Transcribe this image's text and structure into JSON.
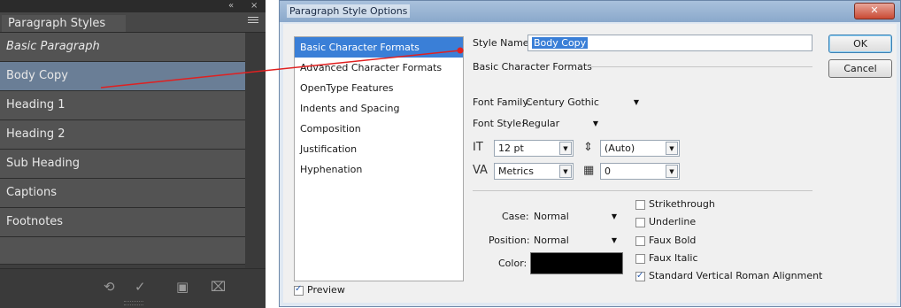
{
  "panel": {
    "tab_title": "Paragraph Styles",
    "collapse_icon": "«",
    "close_icon": "×",
    "styles": [
      {
        "label": "Basic Paragraph"
      },
      {
        "label": "Body Copy"
      },
      {
        "label": "Heading 1"
      },
      {
        "label": "Heading 2"
      },
      {
        "label": "Sub Heading"
      },
      {
        "label": "Captions"
      },
      {
        "label": "Footnotes"
      }
    ],
    "bottom_icons": [
      "clear-overrides-icon",
      "redefine-style-icon",
      "new-style-icon",
      "delete-style-icon"
    ]
  },
  "dialog": {
    "title": "Paragraph Style Options",
    "categories": [
      "Basic Character Formats",
      "Advanced Character Formats",
      "OpenType Features",
      "Indents and Spacing",
      "Composition",
      "Justification",
      "Hyphenation"
    ],
    "preview_label": "Preview",
    "style_name_label": "Style Name:",
    "style_name_value": "Body Copy",
    "section_title": "Basic Character Formats",
    "font_family_label": "Font Family:",
    "font_family_value": "Century Gothic",
    "font_style_label": "Font Style:",
    "font_style_value": "Regular",
    "size_value": "12 pt",
    "leading_value": "(Auto)",
    "kerning_value": "Metrics",
    "tracking_value": "0",
    "case_label": "Case:",
    "case_value": "Normal",
    "position_label": "Position:",
    "position_value": "Normal",
    "color_label": "Color:",
    "color_value": "#000000",
    "checkboxes": {
      "strikethrough": "Strikethrough",
      "underline": "Underline",
      "faux_bold": "Faux Bold",
      "faux_italic": "Faux Italic",
      "svra": "Standard Vertical Roman Alignment"
    },
    "ok_label": "OK",
    "cancel_label": "Cancel"
  },
  "colors": {
    "panel_bg": "#3e3e3e",
    "selected_row": "#6a7e96",
    "selection_blue": "#3a7fd7",
    "connector": "#e02020"
  }
}
